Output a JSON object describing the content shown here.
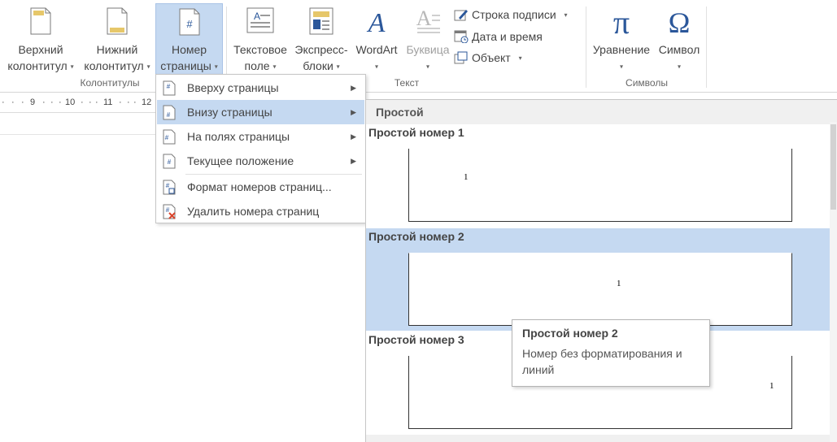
{
  "ribbon": {
    "header_footer": {
      "header_btn": {
        "line1": "Верхний",
        "line2": "колонтитул"
      },
      "footer_btn": {
        "line1": "Нижний",
        "line2": "колонтитул"
      },
      "page_number_btn": {
        "line1": "Номер",
        "line2": "страницы"
      },
      "group_label": "Колонтитулы"
    },
    "text": {
      "textbox_btn": {
        "line1": "Текстовое",
        "line2": "поле"
      },
      "quickparts_btn": {
        "line1": "Экспресс-",
        "line2": "блоки"
      },
      "wordart_btn": {
        "line1": "WordArt"
      },
      "dropcap_btn": {
        "line1": "Буквица"
      },
      "signature_line": "Строка подписи",
      "date_time": "Дата и время",
      "object": "Объект",
      "group_label": "Текст"
    },
    "symbols": {
      "equation_btn": {
        "line1": "Уравнение"
      },
      "symbol_btn": {
        "line1": "Символ"
      },
      "group_label": "Символы"
    },
    "accent_color": "#c5d9f1",
    "icon_blue": "#2b579a"
  },
  "ruler": {
    "ticks": [
      "9",
      "10",
      "11",
      "12"
    ]
  },
  "menu": {
    "items": [
      {
        "label": "Вверху страницы",
        "icon": "page-number-top-icon",
        "submenu": true,
        "selected": false
      },
      {
        "label": "Внизу страницы",
        "icon": "page-number-bottom-icon",
        "submenu": true,
        "selected": true
      },
      {
        "label": "На полях страницы",
        "icon": "page-number-margins-icon",
        "submenu": true,
        "selected": false
      },
      {
        "label": "Текущее положение",
        "icon": "page-number-current-icon",
        "submenu": true,
        "selected": false
      },
      {
        "label": "Формат номеров страниц...",
        "icon": "format-page-numbers-icon",
        "submenu": false,
        "selected": false
      },
      {
        "label": "Удалить номера страниц",
        "icon": "remove-page-numbers-icon",
        "submenu": false,
        "selected": false
      }
    ]
  },
  "gallery": {
    "section_header": "Простой",
    "items": [
      {
        "title": "Простой номер 1",
        "number": "1",
        "align": "left",
        "selected": false
      },
      {
        "title": "Простой номер 2",
        "number": "1",
        "align": "center",
        "selected": true
      },
      {
        "title": "Простой номер 3",
        "number": "1",
        "align": "right",
        "selected": false
      }
    ]
  },
  "tooltip": {
    "title": "Простой номер 2",
    "description": "Номер без форматирования и линий"
  }
}
